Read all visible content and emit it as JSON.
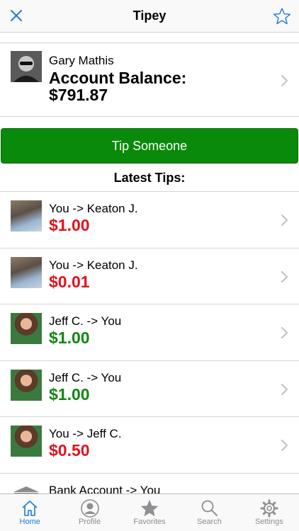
{
  "navbar": {
    "title": "Tipey",
    "close_icon": "close-icon",
    "favorite_icon": "star-icon",
    "accent": "#1e7ad6"
  },
  "account": {
    "name": "Gary Mathis",
    "balance_label": "Account Balance:",
    "balance_value": "$791.87"
  },
  "tip_button": {
    "label": "Tip Someone",
    "color": "#0a8a0a"
  },
  "latest_tips": {
    "title": "Latest Tips:",
    "items": [
      {
        "desc": "You -> Keaton J.",
        "amount": "$1.00",
        "direction": "out",
        "avatar": "keaton"
      },
      {
        "desc": "You -> Keaton J.",
        "amount": "$0.01",
        "direction": "out",
        "avatar": "keaton"
      },
      {
        "desc": "Jeff C. -> You",
        "amount": "$1.00",
        "direction": "in",
        "avatar": "jeff"
      },
      {
        "desc": "Jeff C. -> You",
        "amount": "$1.00",
        "direction": "in",
        "avatar": "jeff"
      },
      {
        "desc": "You -> Jeff C.",
        "amount": "$0.50",
        "direction": "out",
        "avatar": "jeff"
      },
      {
        "desc": "Bank Account -> You",
        "amount": "",
        "direction": "in",
        "avatar": "bank"
      }
    ],
    "colors": {
      "out": "#e4111b",
      "in": "#118711"
    }
  },
  "tabbar": {
    "tabs": [
      {
        "label": "Home",
        "icon": "home-icon",
        "active": true
      },
      {
        "label": "Profile",
        "icon": "profile-icon",
        "active": false
      },
      {
        "label": "Favorites",
        "icon": "star-icon",
        "active": false
      },
      {
        "label": "Search",
        "icon": "search-icon",
        "active": false
      },
      {
        "label": "Settings",
        "icon": "gear-icon",
        "active": false
      }
    ]
  }
}
